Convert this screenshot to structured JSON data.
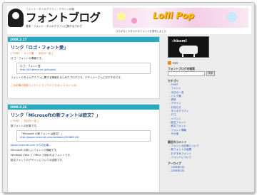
{
  "header": {
    "tagline": "フォント・タイポグラフィ・デザイン情報",
    "title": "フォントブログ",
    "subtitle": "書体・フォント・タイポグラフィに関するブログ",
    "banner_text": "Lolli Pop",
    "banner_note": "ひらがなとカタカナのフォントを発売しました"
  },
  "posts": [
    {
      "date": "2008.2.27",
      "title": "リンク「ロゴ・フォント愛」",
      "meta": "[ FONT ・ リンク集 ・ 今日の一言 ]",
      "lead": "ロゴ・フォントの情報です。",
      "quote_title": "ロゴ・フォント愛",
      "quote_url": "http://d.hatena.ne.jp/logolo/",
      "body": "フォントやタイポグラフィに関する情報をまとめたブログです。デザイナーさんにおすすめです。",
      "footer": "この記事の固定リンク | トラックバック(0) | コメント(0)"
    },
    {
      "date": "2008.2.26",
      "title": "リンク「Microsoftの新フォントは欧文？」",
      "meta": "[ FONT ・ 今日の一言 ]",
      "lead": "新フォントの記事です。",
      "quote_title": "「Microsoft の新フォントは欧文？」",
      "quote_url": "http://japan.internet.com/webtech/20080218/",
      "body1": "japan.internet.com からの記事。",
      "body2": "Microsoft の新しいフォントの情報です。",
      "body3": "Windows Vista と Office で使われるフォントです。",
      "body4": "欧文フォントのデザインについての話題です。"
    }
  ],
  "sidebar": {
    "image_title": ":hbsml",
    "rss_label": "RSS",
    "search_heading": "フォントブログ内検索",
    "search_button": "検索",
    "categories_heading": "カテゴリ",
    "categories": [
      "FONT",
      "フォント",
      "今日の一言",
      "リンク集",
      "書体",
      "デザイン",
      "お知らせ",
      "タイポグラフィ",
      "ロゴ",
      "イベント",
      "欧文フォント",
      "和文フォント",
      "フォント情報",
      "その他"
    ],
    "recent_heading": "最近のコメント",
    "recent": [
      "フォントの記事について",
      "新フォントの話題",
      "おすすめフォント",
      "フォントについて"
    ],
    "archive_heading": "アーカイブ",
    "archive": [
      "2008年2月",
      "2008年1月"
    ]
  }
}
